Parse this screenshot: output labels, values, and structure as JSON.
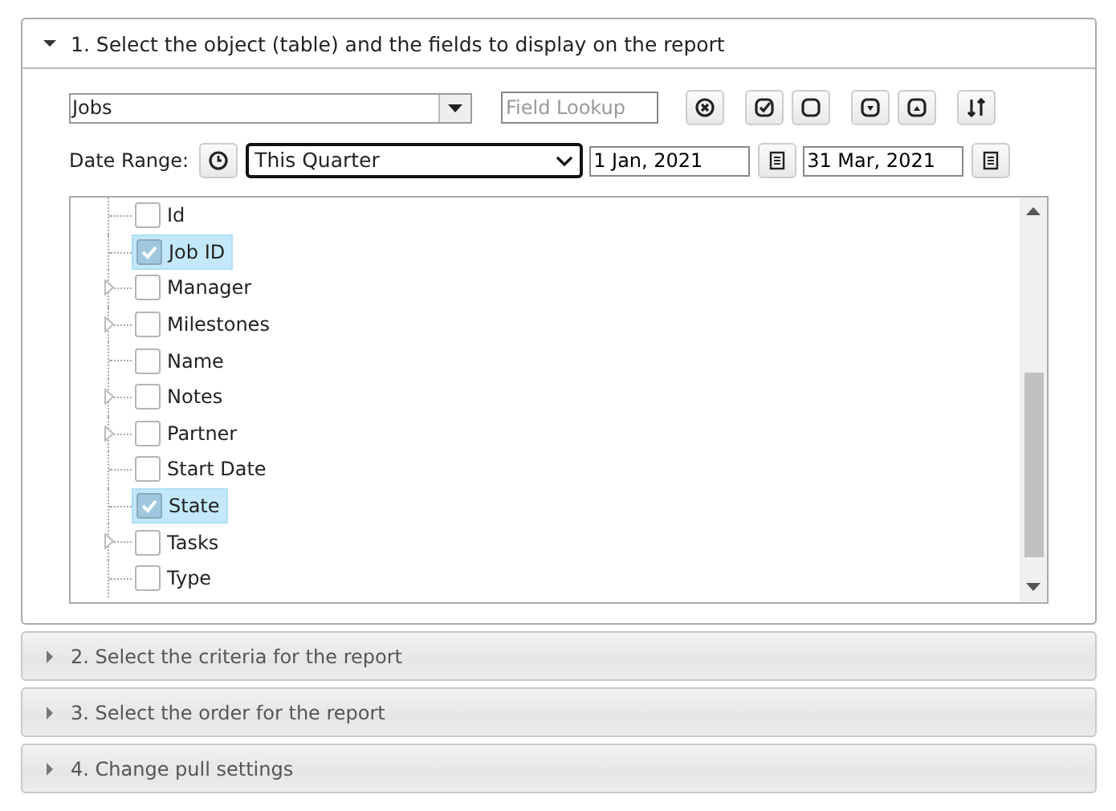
{
  "sections": [
    {
      "title": "1. Select the object (table) and the fields to display on the report",
      "expanded": true
    },
    {
      "title": "2. Select the criteria for the report",
      "expanded": false
    },
    {
      "title": "3. Select the order for the report",
      "expanded": false
    },
    {
      "title": "4. Change pull settings",
      "expanded": false
    }
  ],
  "object_select": {
    "value": "Jobs"
  },
  "field_lookup": {
    "placeholder": "Field Lookup"
  },
  "date_range": {
    "label": "Date Range:",
    "preset": "This Quarter",
    "start": "1 Jan, 2021",
    "end": "31 Mar, 2021"
  },
  "fields": [
    {
      "label": "Id",
      "kind": "field",
      "checked": false
    },
    {
      "label": "Job ID",
      "kind": "field",
      "checked": true
    },
    {
      "label": "Manager",
      "kind": "object",
      "checked": false
    },
    {
      "label": "Milestones",
      "kind": "object",
      "checked": false
    },
    {
      "label": "Name",
      "kind": "field",
      "checked": false
    },
    {
      "label": "Notes",
      "kind": "object",
      "checked": false
    },
    {
      "label": "Partner",
      "kind": "object",
      "checked": false
    },
    {
      "label": "Start Date",
      "kind": "field",
      "checked": false
    },
    {
      "label": "State",
      "kind": "field",
      "checked": true
    },
    {
      "label": "Tasks",
      "kind": "object",
      "checked": false
    },
    {
      "label": "Type",
      "kind": "field",
      "checked": false
    }
  ]
}
